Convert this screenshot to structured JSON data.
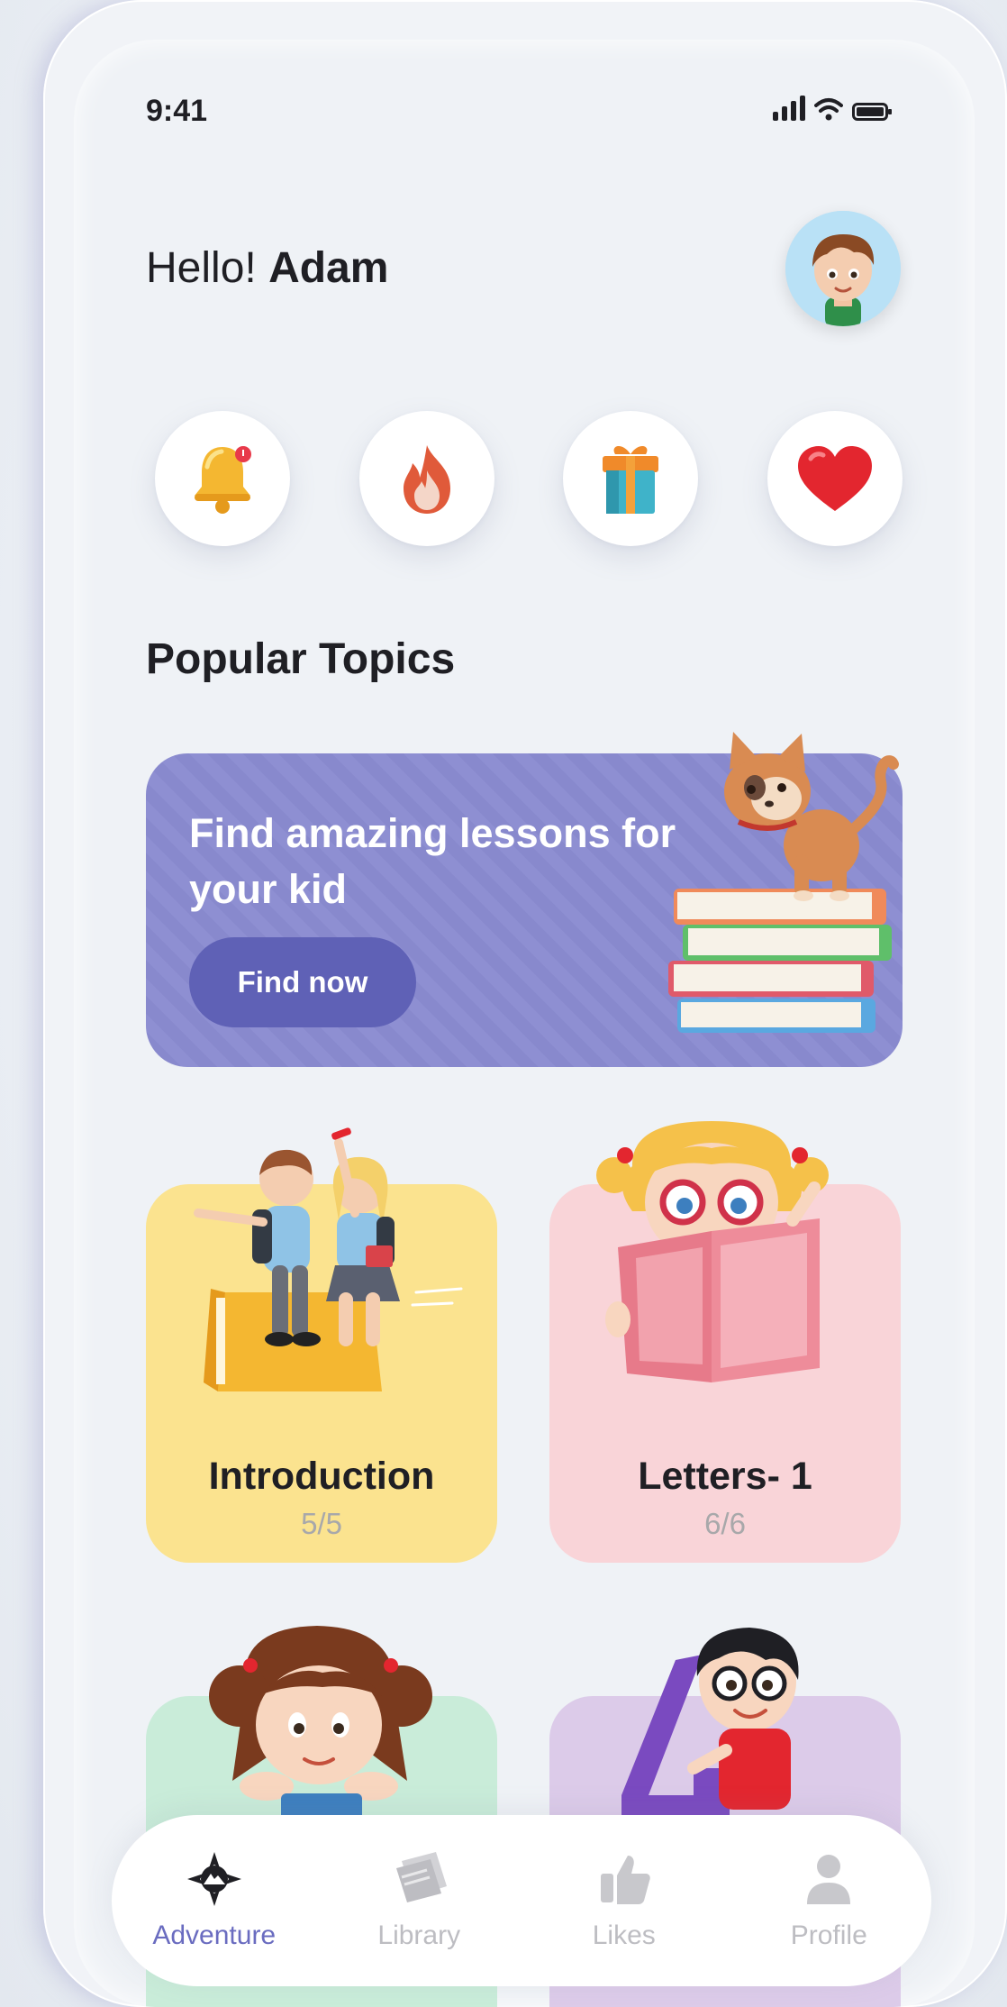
{
  "status_bar": {
    "time": "9:41"
  },
  "header": {
    "greeting_prefix": "Hello!",
    "user_name": "Adam"
  },
  "quick_actions": [
    {
      "icon": "bell-icon"
    },
    {
      "icon": "fire-icon"
    },
    {
      "icon": "gift-icon"
    },
    {
      "icon": "heart-icon"
    }
  ],
  "section": {
    "title": "Popular Topics"
  },
  "banner": {
    "text": "Find amazing lessons for your kid",
    "button_label": "Find now",
    "color": "#8e8fd2"
  },
  "topics": [
    {
      "title": "Introduction",
      "count": "5/5",
      "color": "#fbe38f"
    },
    {
      "title": "Letters- 1",
      "count": "6/6",
      "color": "#f9d4d8"
    },
    {
      "title": "",
      "count": "",
      "color": "#c9ecd9"
    },
    {
      "title": "",
      "count": "",
      "color": "#dccbe9"
    }
  ],
  "bottom_nav": [
    {
      "label": "Adventure",
      "icon": "compass-icon",
      "active": true
    },
    {
      "label": "Library",
      "icon": "book-icon",
      "active": false
    },
    {
      "label": "Likes",
      "icon": "thumbs-up-icon",
      "active": false
    },
    {
      "label": "Profile",
      "icon": "user-icon",
      "active": false
    }
  ],
  "colors": {
    "accent": "#6a6cc0",
    "button": "#5f61b6"
  }
}
